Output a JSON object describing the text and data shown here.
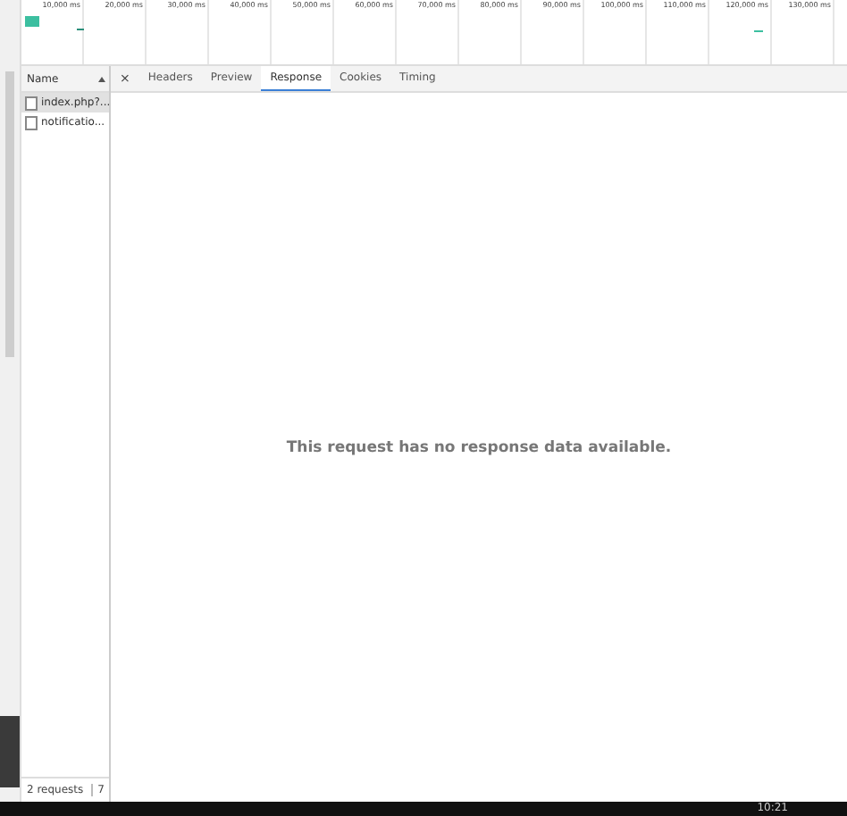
{
  "timeline": {
    "ticks": [
      "10,000 ms",
      "20,000 ms",
      "30,000 ms",
      "40,000 ms",
      "50,000 ms",
      "60,000 ms",
      "70,000 ms",
      "80,000 ms",
      "90,000 ms",
      "100,000 ms",
      "110,000 ms",
      "120,000 ms",
      "130,000 ms"
    ]
  },
  "requests": {
    "column": "Name",
    "items": [
      {
        "name": "index.php?...",
        "selected": true
      },
      {
        "name": "notificatio...",
        "selected": false
      }
    ]
  },
  "tabs": [
    {
      "label": "Headers",
      "selected": false
    },
    {
      "label": "Preview",
      "selected": false
    },
    {
      "label": "Response",
      "selected": true
    },
    {
      "label": "Cookies",
      "selected": false
    },
    {
      "label": "Timing",
      "selected": false
    }
  ],
  "close": "×",
  "message": "This request has no response data available.",
  "status": [
    "2 requests",
    "7"
  ],
  "taskbar": {
    "time": "10:21"
  }
}
